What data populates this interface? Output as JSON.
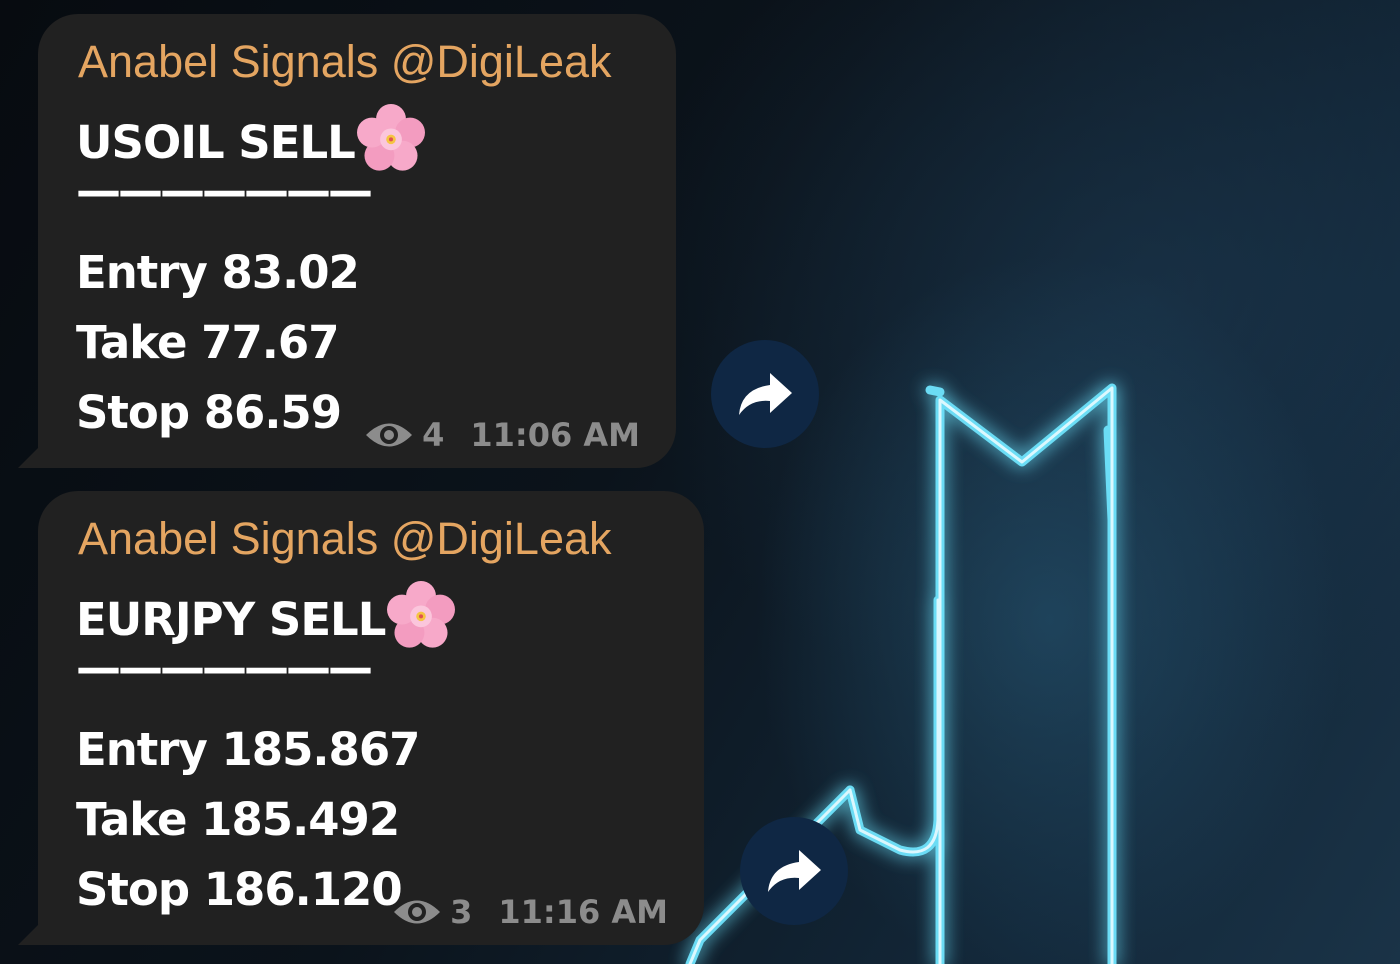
{
  "messages": [
    {
      "sender": "Anabel Signals @DigiLeak",
      "title": "USOIL SELL",
      "title_emoji": "cherry-blossom",
      "divider": "———————",
      "entry": "Entry 83.02",
      "take": "Take 77.67",
      "stop": "Stop 86.59",
      "views": "4",
      "time": "11:06 AM"
    },
    {
      "sender": "Anabel Signals @DigiLeak",
      "title": "EURJPY SELL",
      "title_emoji": "cherry-blossom",
      "divider": "———————",
      "entry": "Entry 185.867",
      "take": "Take 185.492",
      "stop": "Stop 186.120",
      "views": "3",
      "time": "11:16 AM"
    }
  ],
  "icons": {
    "views": "eye-icon",
    "forward": "share-arrow-icon",
    "emoji": "cherry-blossom-icon"
  },
  "colors": {
    "bubble_bg": "#212121",
    "sender_name": "#e4a561",
    "meta_text": "#8c8c8c",
    "forward_button": "#0f2744",
    "neon_accent": "#6fe6ff"
  }
}
